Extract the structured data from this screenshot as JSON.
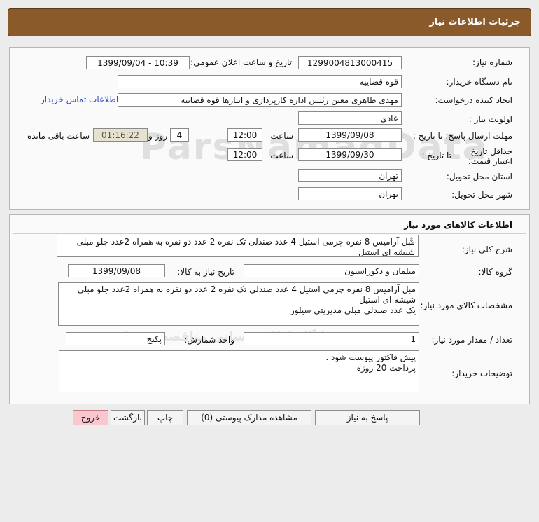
{
  "header": {
    "title": "جزئیات اطلاعات نیاز"
  },
  "info": {
    "need_number_label": "شماره نیاز:",
    "need_number": "1299004813000415",
    "announce_label": "تاریخ و ساعت اعلان عمومی:",
    "announce_value": "1399/09/04 - 10:39",
    "buyer_org_label": "نام دستگاه خریدار:",
    "buyer_org": "قوه قضاییه",
    "creator_label": "ایجاد کننده درخواست:",
    "creator": "مهدی طاهری معین رئیس اداره کارپردازی و انبارها قوه قضاییه",
    "contact_link": "اطلاعات تماس خریدار",
    "priority_label": "اولویت نیاز :",
    "priority": "عادي",
    "reply_deadline_label": "مهلت ارسال پاسخ: تا تاریخ :",
    "reply_date": "1399/09/08",
    "time_label": "ساعت",
    "reply_time": "12:00",
    "days_value": "4",
    "days_label": "روز و",
    "remaining_time": "01:16:22",
    "remaining_label": "ساعت باقی مانده",
    "price_validity_label": "حداقل تاریخ اعتبار قیمت:",
    "to_date_label": "تا تاریخ :",
    "price_date": "1399/09/30",
    "price_time": "12:00",
    "province_label": "استان محل تحویل:",
    "province": "تهران",
    "city_label": "شهر محل تحویل:",
    "city": "تهران"
  },
  "goods": {
    "section_title": "اطلاعات کالاهای مورد نیاز",
    "desc_label": "شرح کلی نیاز:",
    "desc": "مبل آرامیس 8 نفره چرمی استیل 4 عدد صندلی تک نفره 2 عدد دو نفره به همراه 2عدد جلو مبلی شیشه ای استیل",
    "group_label": "گروه کالا:",
    "group": "مبلمان و دکوراسیون",
    "need_date_label": "تاریخ نیاز به کالا:",
    "need_date": "1399/09/08",
    "spec_label": "مشخصات کالاي مورد نياز:",
    "spec": "مبل آرامیس 8 نفره چرمی استیل 4 عدد صندلی تک نفره 2 عدد دو نفره به همراه 2عدد جلو مبلی شیشه ای استیل\nیک عدد صندلی مبلی مدیریتی سیلور",
    "qty_label": "تعداد / مقدار مورد نیاز:",
    "qty": "1",
    "unit_label": "واحد شمارش:",
    "unit": "پکیج",
    "notes_label": "توضیحات خریدار:",
    "notes": "پیش فاکتور پیوست شود .\nپرداخت 20 روزه"
  },
  "buttons": {
    "reply": "پاسخ به نیاز",
    "attachments": "مشاهده مدارک پیوستی (0)",
    "print": "چاپ",
    "back": "بازگشت",
    "exit": "خروج"
  },
  "colors": {
    "header": "#8b5a2b",
    "timer_bg": "#e5e2cf",
    "exit_bg": "#f9c7cd",
    "link": "#2a4ec8"
  }
}
